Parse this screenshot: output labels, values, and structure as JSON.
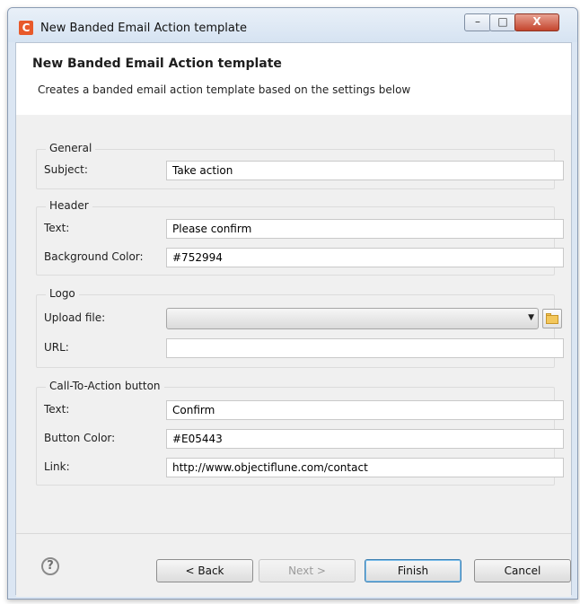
{
  "window": {
    "title": "New Banded Email Action template",
    "icon_letter": "C",
    "controls": {
      "minimize": "–",
      "maximize": "□",
      "close": "X"
    }
  },
  "banner": {
    "title": "New Banded Email Action template",
    "description": "Creates a banded email action template based on the settings below"
  },
  "groups": {
    "general": {
      "title": "General",
      "subject_label": "Subject:",
      "subject_value": "Take action"
    },
    "header": {
      "title": "Header",
      "text_label": "Text:",
      "text_value": "Please confirm",
      "bg_label": "Background Color:",
      "bg_value": "#752994"
    },
    "logo": {
      "title": "Logo",
      "upload_label": "Upload file:",
      "upload_value": "",
      "url_label": "URL:",
      "url_value": ""
    },
    "cta": {
      "title": "Call-To-Action button",
      "text_label": "Text:",
      "text_value": "Confirm",
      "color_label": "Button Color:",
      "color_value": "#E05443",
      "link_label": "Link:",
      "link_value": "http://www.objectiflune.com/contact"
    }
  },
  "footer": {
    "help_icon": "?",
    "back_label": "< Back",
    "next_label": "Next >",
    "finish_label": "Finish",
    "cancel_label": "Cancel"
  },
  "colors": {
    "app_icon": "#e8592a",
    "close_button": "#c4452d",
    "finish_focus": "#3c7fb1"
  }
}
